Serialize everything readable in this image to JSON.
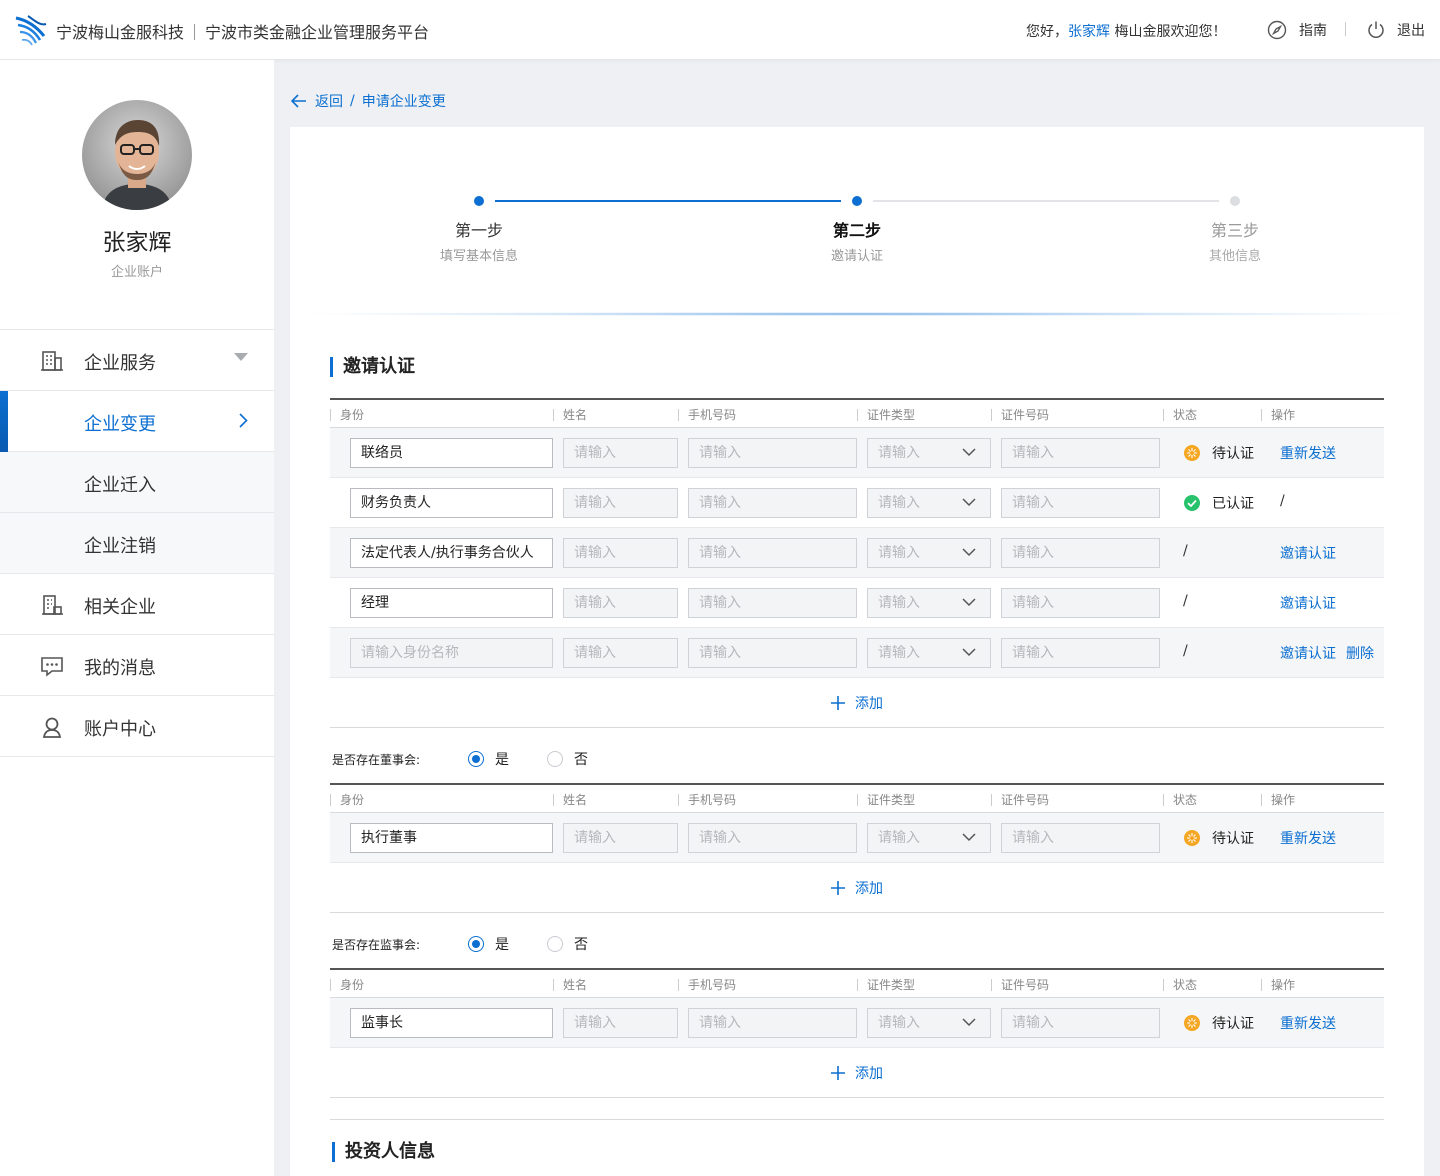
{
  "header": {
    "company": "宁波梅山金服科技",
    "platform": "宁波市类金融企业管理服务平台",
    "greeting_prefix": "您好，",
    "user": "张家辉",
    "greeting_suffix": " 梅山金服欢迎您！",
    "guide": "指南",
    "logout": "退出"
  },
  "sidebar": {
    "name": "张家辉",
    "account_type": "企业账户",
    "items": [
      {
        "label": "企业服务",
        "icon": "building-icon"
      },
      {
        "label": "企业变更"
      },
      {
        "label": "企业迁入"
      },
      {
        "label": "企业注销"
      },
      {
        "label": "相关企业",
        "icon": "buildings-icon"
      },
      {
        "label": "我的消息",
        "icon": "message-icon"
      },
      {
        "label": "账户中心",
        "icon": "user-icon"
      }
    ]
  },
  "breadcrumb": {
    "back": "返回",
    "sep": "/",
    "current": "申请企业变更"
  },
  "steps": [
    {
      "title": "第一步",
      "sub": "填写基本信息"
    },
    {
      "title": "第二步",
      "sub": "邀请认证"
    },
    {
      "title": "第三步",
      "sub": "其他信息"
    }
  ],
  "invite": {
    "title": "邀请认证",
    "columns": [
      "身份",
      "姓名",
      "手机号码",
      "证件类型",
      "证件号码",
      "状态",
      "操作"
    ],
    "placeholder": "请输入",
    "role_placeholder": "请输入身份名称",
    "rows": [
      {
        "role": "联络员",
        "status": "待认证",
        "op": "重新发送"
      },
      {
        "role": "财务负责人",
        "status": "已认证",
        "op": "/"
      },
      {
        "role": "法定代表人/执行事务合伙人",
        "status": "/",
        "op": "邀请认证"
      },
      {
        "role": "经理",
        "status": "/",
        "op": "邀请认证"
      },
      {
        "role": "",
        "status": "/",
        "op": "邀请认证",
        "op2": "删除"
      }
    ],
    "add": "添加"
  },
  "board": {
    "question": "是否存在董事会:",
    "yes": "是",
    "no": "否",
    "rows": [
      {
        "role": "执行董事",
        "status": "待认证",
        "op": "重新发送"
      }
    ]
  },
  "supervisors": {
    "question": "是否存在监事会:",
    "yes": "是",
    "no": "否",
    "rows": [
      {
        "role": "监事长",
        "status": "待认证",
        "op": "重新发送"
      }
    ]
  },
  "investor": {
    "title": "投资人信息"
  },
  "colors": {
    "accent": "#0c6fd1",
    "pending": "#f5a623",
    "done": "#27c26b"
  }
}
